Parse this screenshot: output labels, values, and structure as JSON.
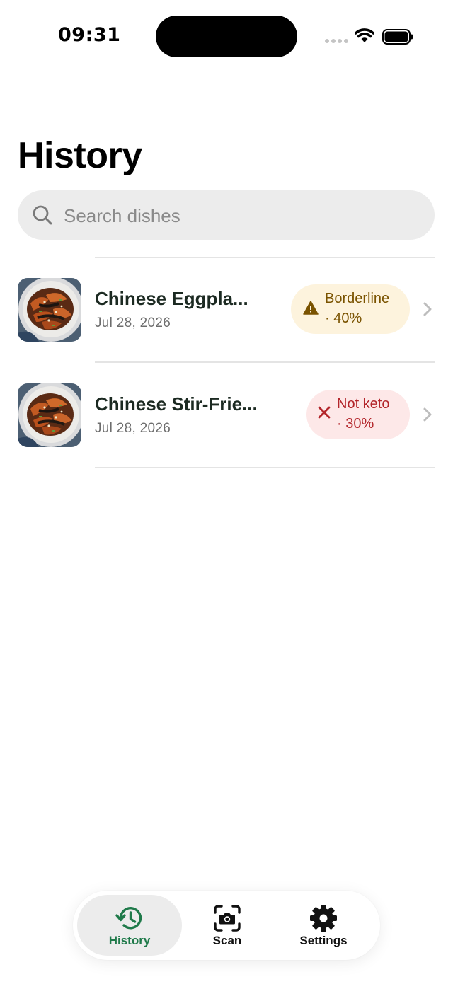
{
  "status_bar": {
    "time": "09:31"
  },
  "page": {
    "title": "History"
  },
  "search": {
    "placeholder": "Search dishes",
    "value": ""
  },
  "history_items": [
    {
      "name": "Chinese Eggpla...",
      "date": "Jul 28, 2026",
      "status_label": "Borderline",
      "score": "· 40%",
      "status": "borderline",
      "icon": "warning-icon"
    },
    {
      "name": "Chinese Stir-Frie...",
      "date": "Jul 28, 2026",
      "status_label": "Not keto",
      "score": "· 30%",
      "status": "not-keto",
      "icon": "close-icon"
    }
  ],
  "tabs": [
    {
      "label": "History",
      "icon": "history-icon",
      "active": true
    },
    {
      "label": "Scan",
      "icon": "camera-scan-icon",
      "active": false
    },
    {
      "label": "Settings",
      "icon": "gear-icon",
      "active": false
    }
  ],
  "colors": {
    "accent_green": "#1f7a4a",
    "borderline_bg": "#fdf3dd",
    "borderline_text": "#7a5300",
    "not_keto_bg": "#fde8e8",
    "not_keto_text": "#b3262b",
    "search_bg": "#ececec"
  }
}
